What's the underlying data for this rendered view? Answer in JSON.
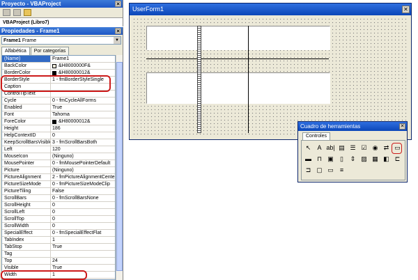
{
  "project": {
    "title": "Proyecto - VBAProject",
    "tree_item": "VBAProject (Libro7)"
  },
  "properties": {
    "title": "Propiedades - Frame1",
    "object_name": "Frame1",
    "object_type": "Frame",
    "tabs": [
      "Alfabética",
      "Por categorías"
    ],
    "rows": [
      {
        "name": "(Name)",
        "value": "Frame1"
      },
      {
        "name": "BackColor",
        "value": "&H8000000F&",
        "swatch": "#ece9d8"
      },
      {
        "name": "BorderColor",
        "value": "&H80000012&",
        "swatch": "#000000"
      },
      {
        "name": "BorderStyle",
        "value": "1 - fmBorderStyleSingle"
      },
      {
        "name": "Caption",
        "value": ""
      },
      {
        "name": "ControlTipText",
        "value": ""
      },
      {
        "name": "Cycle",
        "value": "0 - fmCycleAllForms"
      },
      {
        "name": "Enabled",
        "value": "True"
      },
      {
        "name": "Font",
        "value": "Tahoma"
      },
      {
        "name": "ForeColor",
        "value": "&H80000012&",
        "swatch": "#000000"
      },
      {
        "name": "Height",
        "value": "186"
      },
      {
        "name": "HelpContextID",
        "value": "0"
      },
      {
        "name": "KeepScrollBarsVisible",
        "value": "3 - fmScrollBarsBoth"
      },
      {
        "name": "Left",
        "value": "120"
      },
      {
        "name": "MouseIcon",
        "value": "(Ninguno)"
      },
      {
        "name": "MousePointer",
        "value": "0 - fmMousePointerDefault"
      },
      {
        "name": "Picture",
        "value": "(Ninguno)"
      },
      {
        "name": "PictureAlignment",
        "value": "2 - fmPictureAlignmentCenter"
      },
      {
        "name": "PictureSizeMode",
        "value": "0 - fmPictureSizeModeClip"
      },
      {
        "name": "PictureTiling",
        "value": "False"
      },
      {
        "name": "ScrollBars",
        "value": "0 - fmScrollBarsNone"
      },
      {
        "name": "ScrollHeight",
        "value": "0"
      },
      {
        "name": "ScrollLeft",
        "value": "0"
      },
      {
        "name": "ScrollTop",
        "value": "0"
      },
      {
        "name": "ScrollWidth",
        "value": "0"
      },
      {
        "name": "SpecialEffect",
        "value": "0 - fmSpecialEffectFlat"
      },
      {
        "name": "TabIndex",
        "value": "1"
      },
      {
        "name": "TabStop",
        "value": "True"
      },
      {
        "name": "Tag",
        "value": ""
      },
      {
        "name": "Top",
        "value": "24"
      },
      {
        "name": "Visible",
        "value": "True"
      },
      {
        "name": "Width",
        "value": "1"
      }
    ]
  },
  "userform": {
    "title": "UserForm1"
  },
  "toolbox": {
    "title": "Cuadro de herramientas",
    "tab": "Controles",
    "tools": [
      {
        "icon": "pointer-icon",
        "glyph": "↖"
      },
      {
        "icon": "label-icon",
        "glyph": "A"
      },
      {
        "icon": "textbox-icon",
        "glyph": "ab|"
      },
      {
        "icon": "combobox-icon",
        "glyph": "▤"
      },
      {
        "icon": "listbox-icon",
        "glyph": "☰"
      },
      {
        "icon": "checkbox-icon",
        "glyph": "☑"
      },
      {
        "icon": "optionbutton-icon",
        "glyph": "◉"
      },
      {
        "icon": "togglebutton-icon",
        "glyph": "⇄"
      },
      {
        "icon": "frame-icon",
        "glyph": "▭"
      },
      {
        "icon": "commandbutton-icon",
        "glyph": "▬"
      },
      {
        "icon": "tabstrip-icon",
        "glyph": "⊓"
      },
      {
        "icon": "multipage-icon",
        "glyph": "▣"
      },
      {
        "icon": "scrollbar-icon",
        "glyph": "▯"
      },
      {
        "icon": "spinbutton-icon",
        "glyph": "⇕"
      },
      {
        "icon": "image-icon",
        "glyph": "▨"
      },
      {
        "icon": "refedit-icon",
        "glyph": "▦"
      },
      {
        "icon": "button-a-icon",
        "glyph": "◧"
      },
      {
        "icon": "button-b-icon",
        "glyph": "⊏"
      },
      {
        "icon": "button-c-icon",
        "glyph": "⊐"
      },
      {
        "icon": "button-d-icon",
        "glyph": "▢"
      },
      {
        "icon": "button-e-icon",
        "glyph": "▭"
      },
      {
        "icon": "button-f-icon",
        "glyph": "≡"
      }
    ]
  },
  "colors": {
    "highlight": "#cc1a1a",
    "title_blue": "#0b46b8",
    "selection": "#316ac5"
  }
}
